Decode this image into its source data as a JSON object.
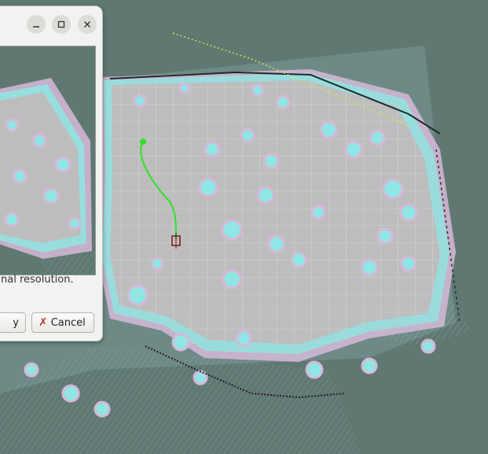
{
  "window": {
    "minimize_icon": "minimize-icon",
    "maximize_icon": "maximize-icon",
    "close_icon": "close-icon"
  },
  "dialog": {
    "message": "nal resolution.",
    "ok_label": "y",
    "cancel_label": "Cancel",
    "cancel_icon": "cancel-x-icon"
  },
  "map": {
    "background_color": "#5f7872",
    "floor_color": "#b9b9b9",
    "inflation_color": "#7ee7e2",
    "inflation_outer_color": "#d9b3d9",
    "path_color": "#2ee02e"
  }
}
